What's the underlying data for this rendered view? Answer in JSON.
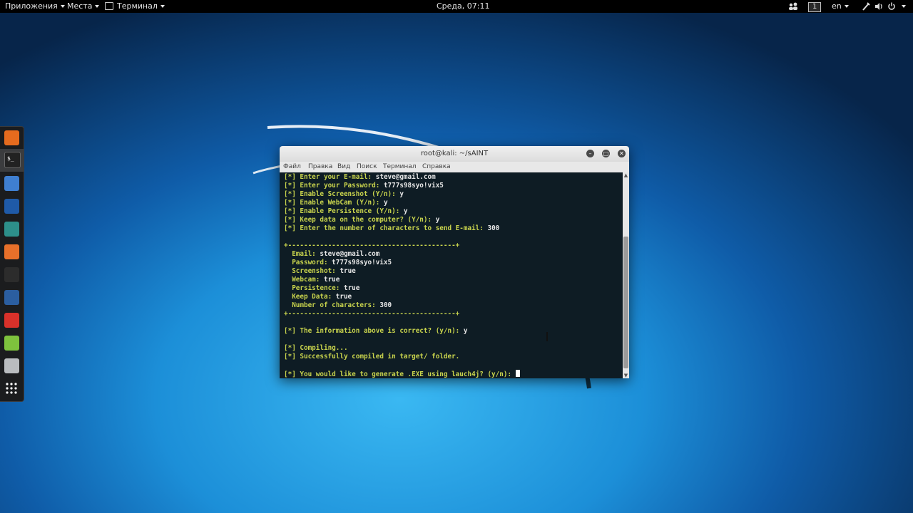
{
  "top_panel": {
    "applications": "Приложения",
    "places": "Места",
    "terminal": "Терминал",
    "clock": "Среда, 07:11",
    "workspace": "1",
    "language": "en"
  },
  "dock": {
    "items": [
      {
        "name": "firefox-icon",
        "color": "#e66b1e"
      },
      {
        "name": "terminal-icon",
        "color": "#222222"
      },
      {
        "name": "files-icon",
        "color": "#3f7fd1"
      },
      {
        "name": "metasploit-icon",
        "color": "#1f5aa8"
      },
      {
        "name": "armitage-icon",
        "color": "#2d8f8a"
      },
      {
        "name": "burpsuite-icon",
        "color": "#e8702a"
      },
      {
        "name": "maltego-icon",
        "color": "#2c2c2c"
      },
      {
        "name": "beef-icon",
        "color": "#2b5ea0"
      },
      {
        "name": "faraday-icon",
        "color": "#d9312a"
      },
      {
        "name": "text-editor-icon",
        "color": "#7ec23d"
      },
      {
        "name": "screenshot-icon",
        "color": "#b9bcbf"
      },
      {
        "name": "show-apps-icon",
        "color": "#ffffff"
      }
    ]
  },
  "window": {
    "title": "root@kali: ~/sAINT",
    "menu": [
      "Файл",
      "Правка",
      "Вид",
      "Поиск",
      "Терминал",
      "Справка"
    ]
  },
  "terminal": {
    "lines": [
      {
        "p": "[*] Enter your E-mail: ",
        "t": "steve@gmail.com"
      },
      {
        "p": "[*] Enter your Password: ",
        "t": "t777s98syo!vix5"
      },
      {
        "p": "[*] Enable Screenshot (Y/n): ",
        "t": "y"
      },
      {
        "p": "[*] Enable WebCam (Y/n): ",
        "t": "y"
      },
      {
        "p": "[*] Enable Persistence (Y/n): ",
        "t": "y"
      },
      {
        "p": "[*] Keep data on the computer? (Y/n): ",
        "t": "y"
      },
      {
        "p": "[*] Enter the number of characters to send E-mail: ",
        "t": "300"
      },
      {
        "p": "",
        "t": ""
      },
      {
        "p": "+------------------------------------------+",
        "t": ""
      },
      {
        "p": "  Email: ",
        "t": "steve@gmail.com"
      },
      {
        "p": "  Password: ",
        "t": "t777s98syo!vix5"
      },
      {
        "p": "  Screenshot: ",
        "t": "true"
      },
      {
        "p": "  Webcam: ",
        "t": "true"
      },
      {
        "p": "  Persistence: ",
        "t": "true"
      },
      {
        "p": "  Keep Data: ",
        "t": "true"
      },
      {
        "p": "  Number of characters: ",
        "t": "300"
      },
      {
        "p": "+------------------------------------------+",
        "t": ""
      },
      {
        "p": "",
        "t": ""
      },
      {
        "p": "[*] The information above is correct? (y/n): ",
        "t": "y"
      },
      {
        "p": "",
        "t": ""
      },
      {
        "p": "[*] Compiling...",
        "t": ""
      },
      {
        "p": "[*] Successfully compiled in target/ folder.",
        "t": ""
      },
      {
        "p": "",
        "t": ""
      },
      {
        "p": "[*] You would like to generate .EXE using lauch4j? (y/n): ",
        "t": ""
      }
    ]
  }
}
